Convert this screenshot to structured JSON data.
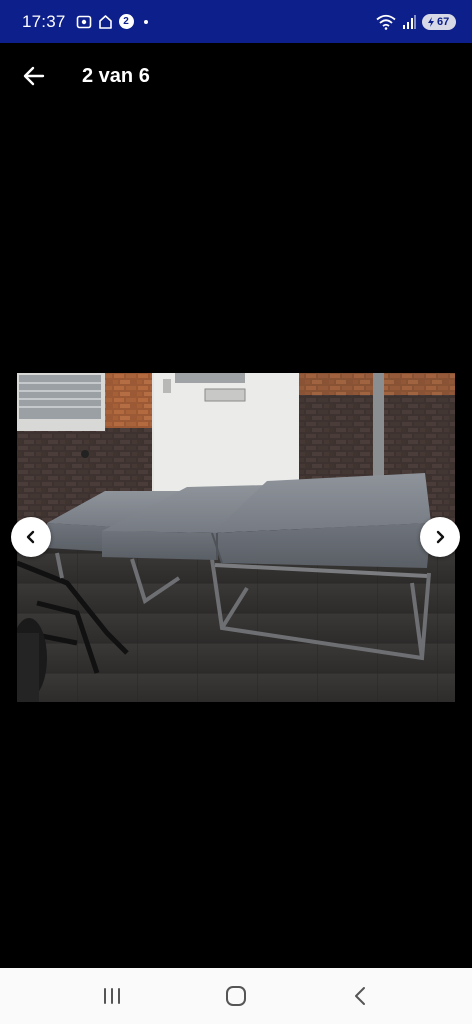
{
  "status_bar": {
    "time": "17:37",
    "notification_badge": "2",
    "battery_level": "67",
    "icons": [
      "screenshot-icon",
      "home-outline-icon",
      "notification-badge-icon",
      "wifi-icon",
      "signal-icon",
      "battery-icon"
    ]
  },
  "app_bar": {
    "back_icon": "arrow-back-icon",
    "title": "2 van 6"
  },
  "gallery": {
    "current_index": 2,
    "total": 6,
    "image_subject": "grey upholstered folding cushion bed on metal frame",
    "prev_icon": "chevron-left-icon",
    "next_icon": "chevron-right-icon"
  },
  "nav_bar": {
    "recent_icon": "recent-apps-icon",
    "home_icon": "home-icon",
    "back_icon": "nav-back-icon"
  },
  "colors": {
    "status_bar_bg": "#0d1f8a",
    "background": "#000000",
    "nav_bar_bg": "#fafafa"
  }
}
